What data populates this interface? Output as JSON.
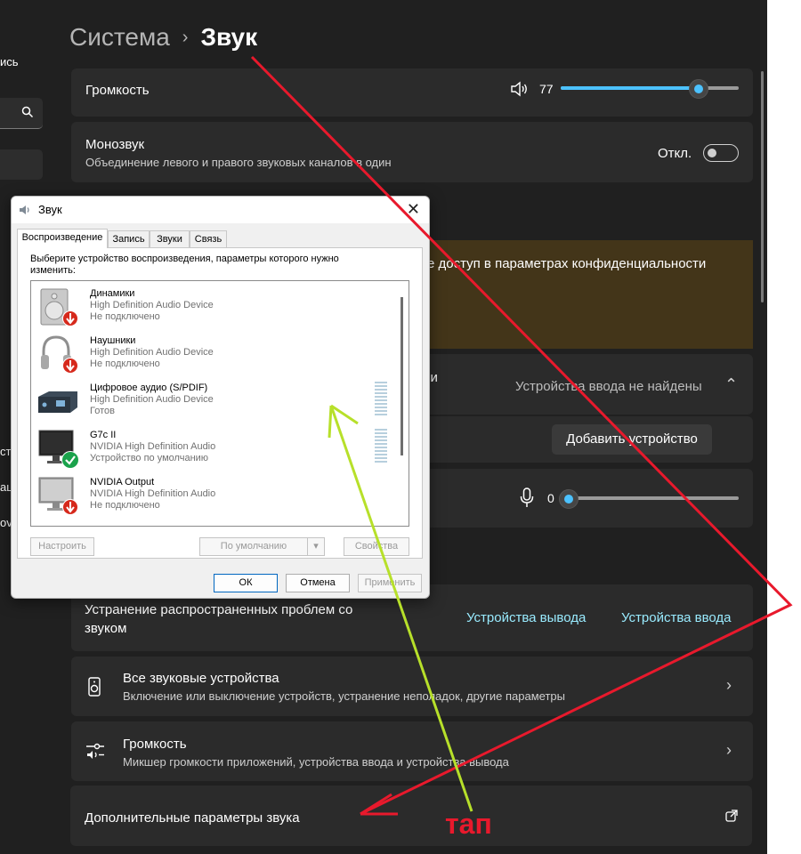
{
  "sidebar": {
    "fragments": [
      "ись",
      "ст",
      "ац",
      "ov"
    ]
  },
  "header": {
    "breadcrumb_parent": "Система",
    "breadcrumb_sep": "›",
    "breadcrumb_current": "Звук"
  },
  "volume": {
    "label": "Громкость",
    "value": "77",
    "level": 0.77
  },
  "mono": {
    "title": "Монозвук",
    "subtitle": "Объединение левого и правого звуковых каналов в один",
    "state": "Откл."
  },
  "privacy_banner": {
    "text": "е доступ в параметрах конфиденциальности"
  },
  "input": {
    "partial_label": "си",
    "no_devices": "Устройства ввода не найдены",
    "add_button": "Добавить устройство",
    "volume_value": "0",
    "level": 0
  },
  "troubleshoot": {
    "title": "Устранение распространенных проблем со звуком",
    "link_output": "Устройства вывода",
    "link_input": "Устройства ввода"
  },
  "all_devices": {
    "title": "Все звуковые устройства",
    "subtitle": "Включение или выключение устройств, устранение неполадок, другие параметры"
  },
  "mixer": {
    "title": "Громкость",
    "subtitle": "Микшер громкости приложений, устройства ввода и устройства вывода"
  },
  "advanced": {
    "title": "Дополнительные параметры звука"
  },
  "dialog": {
    "title": "Звук",
    "tabs": [
      "Воспроизведение",
      "Запись",
      "Звуки",
      "Связь"
    ],
    "hint": "Выберите устройство воспроизведения, параметры которого нужно изменить:",
    "devices": [
      {
        "name": "Динамики",
        "driver": "High Definition Audio Device",
        "status": "Не подключено"
      },
      {
        "name": "Наушники",
        "driver": "High Definition Audio Device",
        "status": "Не подключено"
      },
      {
        "name": "Цифровое аудио (S/PDIF)",
        "driver": "High Definition Audio Device",
        "status": "Готов"
      },
      {
        "name": "G7c II",
        "driver": "NVIDIA High Definition Audio",
        "status": "Устройство по умолчанию"
      },
      {
        "name": "NVIDIA Output",
        "driver": "NVIDIA High Definition Audio",
        "status": "Не подключено"
      }
    ],
    "btn_configure": "Настроить",
    "btn_default": "По умолчанию",
    "btn_properties": "Свойства",
    "btn_ok": "ОК",
    "btn_cancel": "Отмена",
    "btn_apply": "Применить"
  },
  "annotation": {
    "tap_label": "тап"
  },
  "colors": {
    "background": "#202020",
    "card": "#2b2b2b",
    "accent": "#4cc2ff",
    "link": "#99ebff",
    "warning_banner": "#433519",
    "annotation_red": "#e8192c",
    "annotation_green": "#b7e02a"
  }
}
